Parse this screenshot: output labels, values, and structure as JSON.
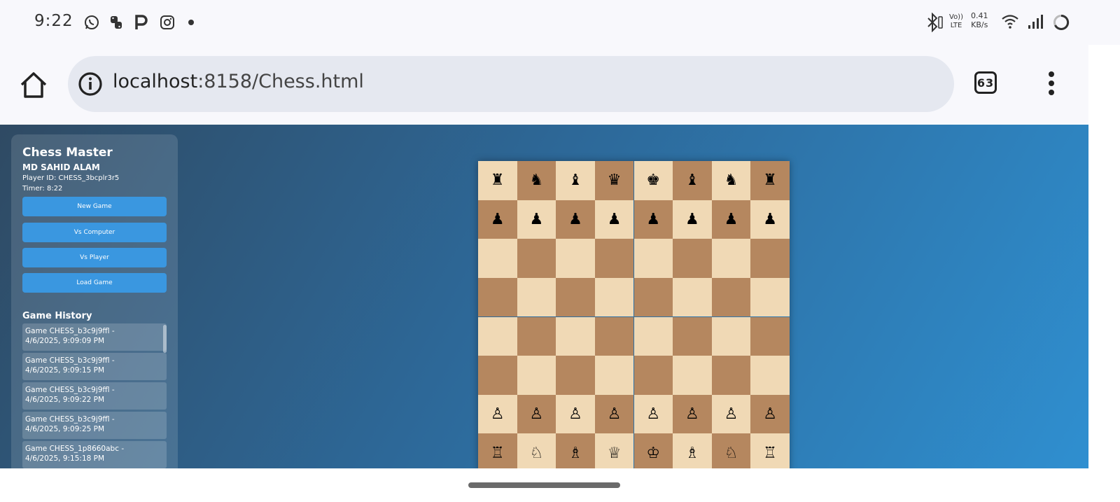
{
  "status_bar": {
    "time": "9:22",
    "left_icons": [
      "whatsapp-icon",
      "python-icon",
      "p-app-icon",
      "instagram-icon",
      "dot-icon"
    ],
    "lte_top": "Vo))",
    "lte_bottom": "LTE",
    "speed_value": "0.41",
    "speed_unit": "KB/s",
    "right_icons": [
      "bluetooth-icon",
      "wifi-icon",
      "signal-icon",
      "battery-ring-icon"
    ]
  },
  "browser": {
    "url_host": "localhost",
    "url_rest": ":8158/Chess.html",
    "tab_count": "63"
  },
  "sidebar": {
    "title": "Chess Master",
    "player_name": "MD SAHID ALAM",
    "player_id": "Player ID: CHESS_3bcplr3r5",
    "timer": "Timer: 8:22",
    "buttons": {
      "new_game": "New Game",
      "vs_computer": "Vs Computer",
      "vs_player": "Vs Player",
      "load_game": "Load Game"
    },
    "history_title": "Game History",
    "history": [
      {
        "line1": "Game CHESS_b3c9j9ffl -",
        "line2": "4/6/2025, 9:09:09 PM"
      },
      {
        "line1": "Game CHESS_b3c9j9ffl -",
        "line2": "4/6/2025, 9:09:15 PM"
      },
      {
        "line1": "Game CHESS_b3c9j9ffl -",
        "line2": "4/6/2025, 9:09:22 PM"
      },
      {
        "line1": "Game CHESS_b3c9j9ffl -",
        "line2": "4/6/2025, 9:09:25 PM"
      },
      {
        "line1": "Game CHESS_1p8660abc -",
        "line2": "4/6/2025, 9:15:18 PM"
      }
    ]
  },
  "board": {
    "rows": [
      [
        "♜",
        "♞",
        "♝",
        "♛",
        "♚",
        "♝",
        "♞",
        "♜"
      ],
      [
        "♟",
        "♟",
        "♟",
        "♟",
        "♟",
        "♟",
        "♟",
        "♟"
      ],
      [
        "",
        "",
        "",
        "",
        "",
        "",
        "",
        ""
      ],
      [
        "",
        "",
        "",
        "",
        "",
        "",
        "",
        ""
      ],
      [
        "",
        "",
        "",
        "",
        "",
        "",
        "",
        ""
      ],
      [
        "",
        "",
        "",
        "",
        "",
        "",
        "",
        ""
      ],
      [
        "♙",
        "♙",
        "♙",
        "♙",
        "♙",
        "♙",
        "♙",
        "♙"
      ],
      [
        "♖",
        "♘",
        "♗",
        "♕",
        "♔",
        "♗",
        "♘",
        "♖"
      ]
    ],
    "light_color": "#f0d9b5",
    "dark_color": "#b5875f"
  },
  "colors": {
    "button_blue": "#3a97e0",
    "page_gradient_start": "#2f4a63",
    "page_gradient_end": "#2f8fd0"
  }
}
